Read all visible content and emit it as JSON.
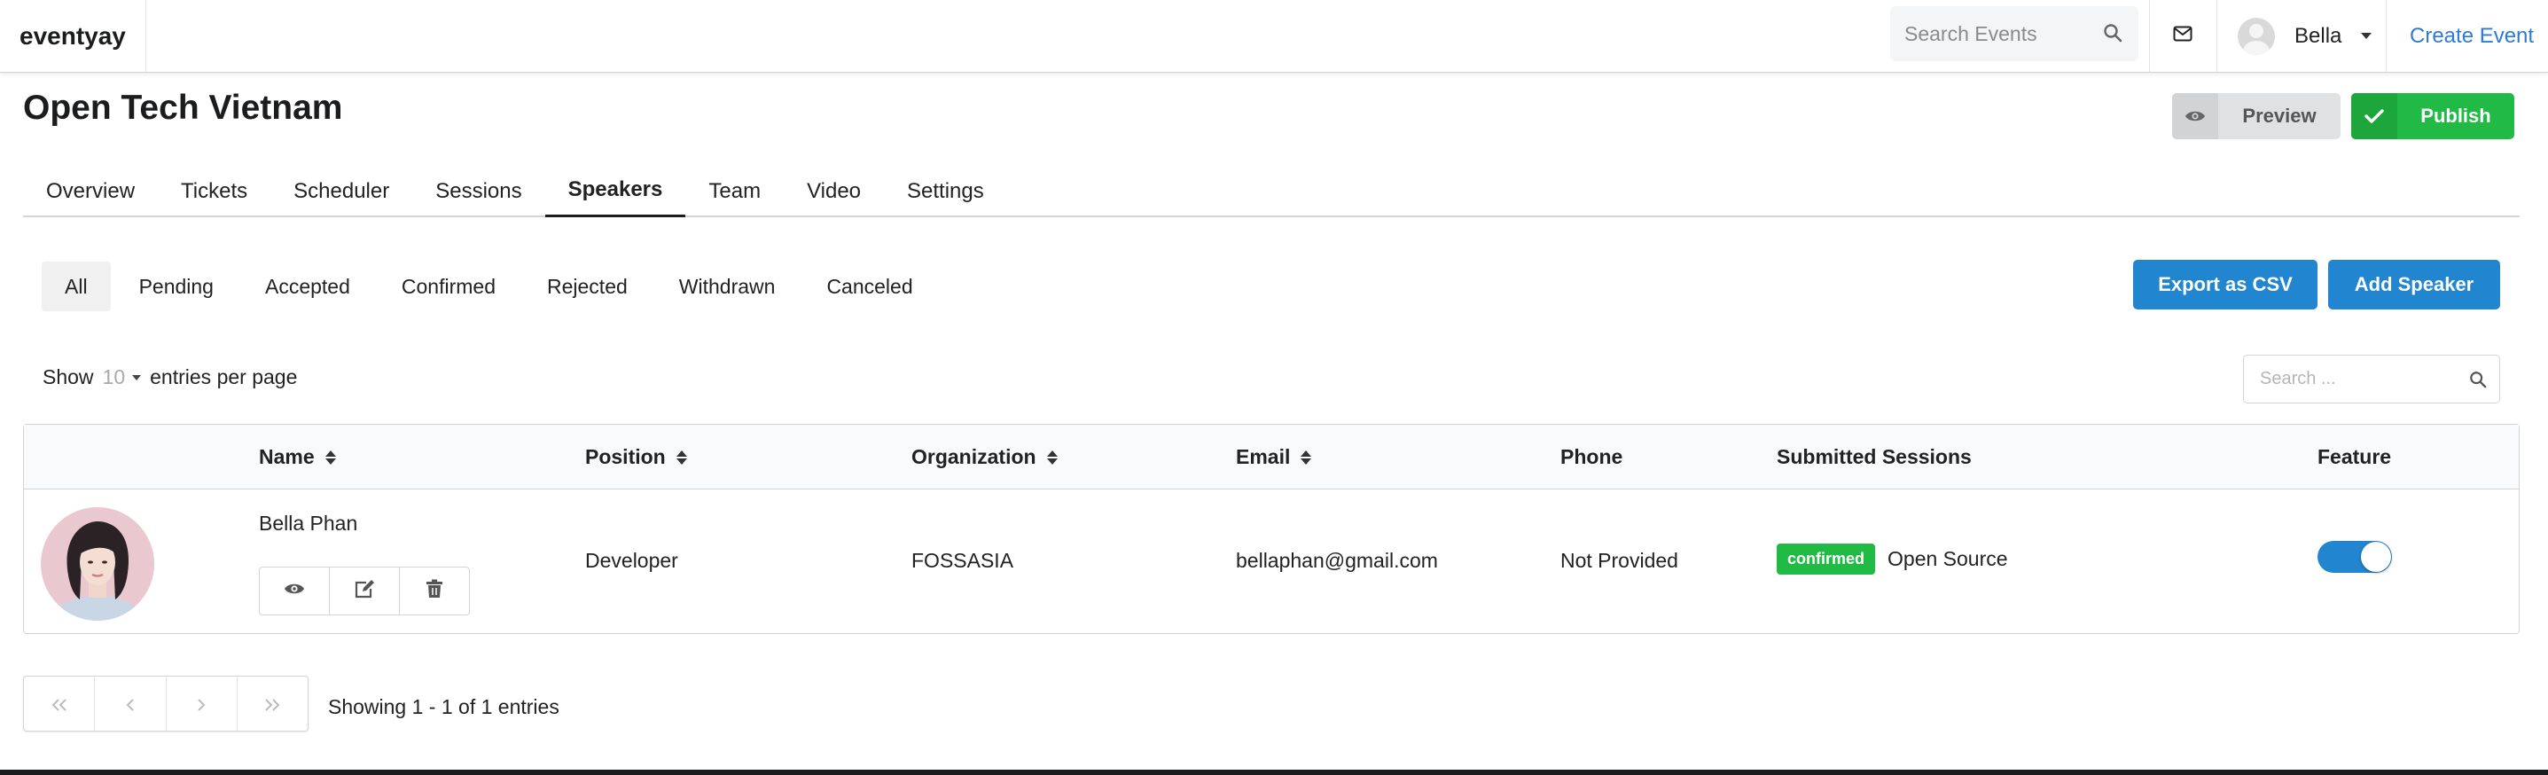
{
  "navbar": {
    "brand": "eventyay",
    "search_placeholder": "Search Events",
    "user_name": "Bella",
    "create_event": "Create Event"
  },
  "header": {
    "event_title": "Open Tech Vietnam",
    "preview_label": "Preview",
    "publish_label": "Publish"
  },
  "tabs": [
    "Overview",
    "Tickets",
    "Scheduler",
    "Sessions",
    "Speakers",
    "Team",
    "Video",
    "Settings"
  ],
  "active_tab": "Speakers",
  "filters": [
    "All",
    "Pending",
    "Accepted",
    "Confirmed",
    "Rejected",
    "Withdrawn",
    "Canceled"
  ],
  "active_filter": "All",
  "actions": {
    "export_csv": "Export as CSV",
    "add_speaker": "Add Speaker"
  },
  "entries": {
    "show": "Show",
    "per_page_value": "10",
    "per_page_suffix": "entries per page",
    "search_placeholder": "Search ..."
  },
  "table": {
    "columns": [
      "Name",
      "Position",
      "Organization",
      "Email",
      "Phone",
      "Submitted Sessions",
      "Feature"
    ],
    "rows": [
      {
        "name": "Bella Phan",
        "position": "Developer",
        "organization": "FOSSASIA",
        "email": "bellaphan@gmail.com",
        "phone": "Not Provided",
        "session_status": "confirmed",
        "session_title": "Open Source",
        "featured": true
      }
    ]
  },
  "pagination": {
    "summary": "Showing 1 - 1 of 1 entries"
  },
  "colors": {
    "primary": "#2185d0",
    "success": "#21ba45",
    "link": "#2c7bd6"
  }
}
